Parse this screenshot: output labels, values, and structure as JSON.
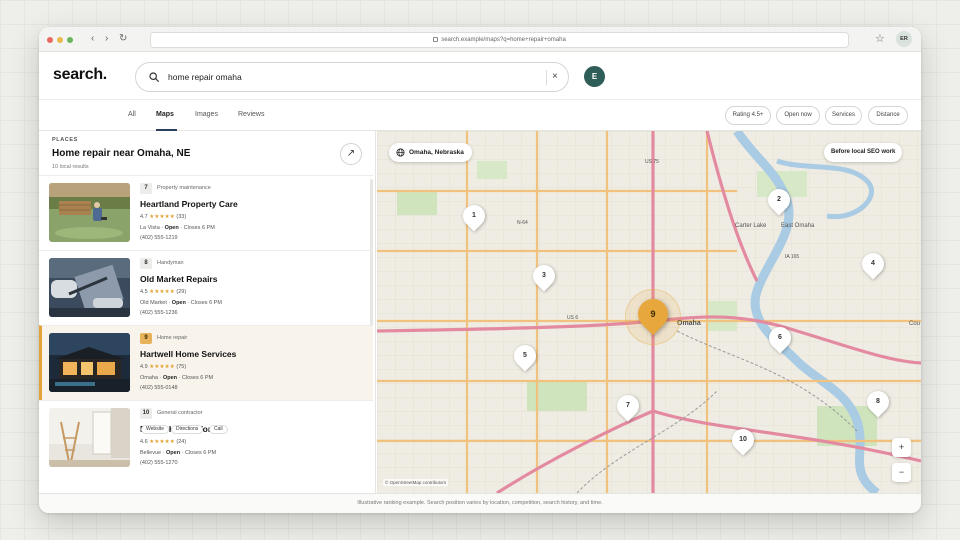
{
  "browser": {
    "url": "search.example/maps?q=home+repair+omaha",
    "avatar_initials": "ER"
  },
  "header": {
    "logo": "search.",
    "query": "home repair omaha",
    "user_initial": "E"
  },
  "tabs": [
    "All",
    "Maps",
    "Images",
    "Reviews"
  ],
  "active_tab": "Maps",
  "filters": [
    "Rating 4.5+",
    "Open now",
    "Services",
    "Distance"
  ],
  "panel": {
    "section_label": "PLACES",
    "title": "Home repair near Omaha, NE",
    "subtitle": "10 local results"
  },
  "listings": [
    {
      "rank": "7",
      "category": "Property maintenance",
      "name": "Heartland Property Care",
      "rating": "4.7",
      "stars": "★★★★★",
      "reviews": "(33)",
      "location": "La Vista",
      "status": "Open",
      "hours": "Closes 6 PM",
      "phone": "(402) 555-1219"
    },
    {
      "rank": "8",
      "category": "Handyman",
      "name": "Old Market Repairs",
      "rating": "4.5",
      "stars": "★★★★★",
      "reviews": "(29)",
      "location": "Old Market",
      "status": "Open",
      "hours": "Closes 6 PM",
      "phone": "(402) 555-1236"
    },
    {
      "rank": "9",
      "category": "Home repair",
      "name": "Hartwell Home Services",
      "rating": "4.9",
      "stars": "★★★★★",
      "reviews": "(75)",
      "location": "Omaha",
      "status": "Open",
      "hours": "Closes 6 PM",
      "phone": "(402) 555-0148"
    },
    {
      "rank": "10",
      "category": "General contractor",
      "name": "Prairie Home Works",
      "rating": "4.6",
      "stars": "★★★★★",
      "reviews": "(24)",
      "location": "Bellevue",
      "status": "Open",
      "hours": "Closes 6 PM",
      "phone": "(402) 555-1270"
    }
  ],
  "selected_actions": [
    "Website",
    "Directions",
    "Call"
  ],
  "map": {
    "location_chip": "Omaha, Nebraska",
    "compare_chip": "Before local SEO work",
    "attribution": "© OpenStreetMap contributors",
    "zoom_in": "+",
    "zoom_out": "−",
    "locate": "⌖",
    "labels": [
      "Omaha",
      "Carter Lake",
      "East Omaha",
      "US 75",
      "US 6",
      "IA 165",
      "N-64",
      "Cou"
    ],
    "pins": [
      "1",
      "2",
      "3",
      "4",
      "5",
      "6",
      "7",
      "8",
      "9",
      "10"
    ],
    "highlight_pin": "9"
  },
  "colors": {
    "accent_gold": "#e7a73c",
    "avatar_green": "#2f5d57",
    "tab_underline": "#2a3f5e",
    "star": "#e3a02e"
  },
  "footer": "Illustrative ranking example. Search position varies by location, competition, search history, and time."
}
